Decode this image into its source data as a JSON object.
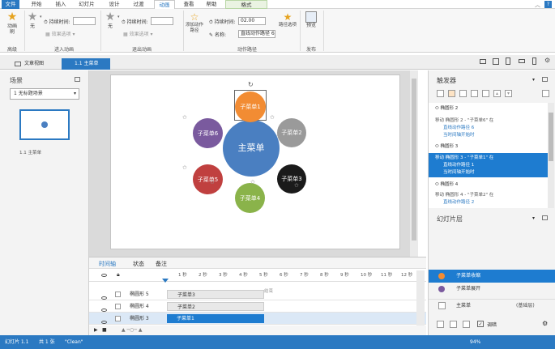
{
  "menu": {
    "tabs": [
      "文件",
      "开始",
      "插入",
      "幻灯片",
      "设计",
      "过渡",
      "动画",
      "查看",
      "帮助",
      "格式"
    ],
    "active_tab": "动画",
    "context_tab": "格式"
  },
  "ribbon": {
    "preview": {
      "label1": "动画",
      "label2": "刷",
      "group": "高级"
    },
    "entrance": {
      "none": "无",
      "duration_label": "持续时间:",
      "effect_options": "效果选项",
      "group": "进入动画"
    },
    "exit": {
      "none": "无",
      "duration_label": "持续时间:",
      "effect_options": "效果选项",
      "group": "退出动画"
    },
    "path": {
      "add": "添加动作路径",
      "duration_label": "持续时间:",
      "duration_value": "02.00",
      "name_label": "名称:",
      "name_value": "直线动作路径 6",
      "path_options": "路径选项",
      "group": "动作路径"
    },
    "publish": {
      "label": "预览",
      "group": "发布"
    }
  },
  "doc_tabs": {
    "tab1": "文章视图",
    "tab2": "1.1 主菜单"
  },
  "scenes": {
    "title": "场景",
    "dropdown": "1 无标题场景",
    "thumb_label": "1.1 主菜单"
  },
  "slide": {
    "center": "主菜单",
    "items": [
      "子菜单1",
      "子菜单2",
      "子菜单3",
      "子菜单4",
      "子菜单5",
      "子菜单6"
    ],
    "colors": {
      "center": "#4a7fc1",
      "s1": "#f28c33",
      "s2": "#9a9a9a",
      "s3": "#1a1a1a",
      "s4": "#8ab34a",
      "s5": "#c0403f",
      "s6": "#7a5a9e"
    }
  },
  "timeline": {
    "tabs": [
      "时间轴",
      "状态",
      "备注"
    ],
    "ticks": [
      "1 秒",
      "2 秒",
      "3 秒",
      "4 秒",
      "5 秒",
      "6 秒",
      "7 秒",
      "8 秒",
      "9 秒",
      "10 秒",
      "11 秒",
      "12 秒"
    ],
    "rows": [
      {
        "name": "椭圆形 5",
        "label": "子菜单3"
      },
      {
        "name": "椭圆形 4",
        "label": "子菜单2"
      },
      {
        "name": "椭圆形 3",
        "label": "子菜单1"
      }
    ],
    "end_label": "结束"
  },
  "triggers": {
    "title": "触发器",
    "groups": [
      {
        "header": "椭圆形 2",
        "line1": "移动 椭圆形 2 - \"子菜单6\" 在",
        "line2": "直线动作路径 6",
        "line3": "当时间轴开始时"
      },
      {
        "header": "椭圆形 3",
        "line1": "移动 椭圆形 3 - \"子菜单1\" 在",
        "line2": "直线动作路径 1",
        "line3": "当时间轴开始时"
      },
      {
        "header": "椭圆形 4",
        "line1": "移动 椭圆形 4 - \"子菜单2\" 在",
        "line2": "直线动作路径 2"
      }
    ]
  },
  "layers": {
    "title": "幻灯片层",
    "items": [
      "子菜单收缩",
      "子菜单展开"
    ],
    "base": "主菜单",
    "base_tag": "(基础层)",
    "dim_label": "调暗"
  },
  "status": {
    "slide": "幻灯片 1.1",
    "total": "共 1 张",
    "theme": "\"Clean\"",
    "zoom": "94%"
  }
}
